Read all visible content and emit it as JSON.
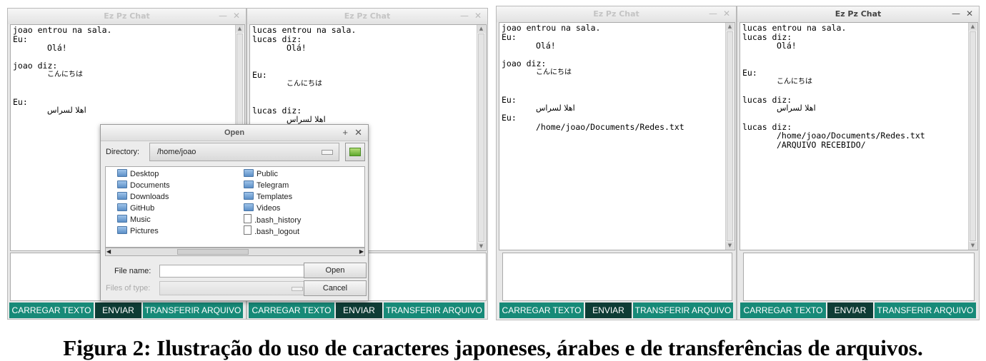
{
  "windows": [
    {
      "title": "Ez Pz Chat",
      "lines": [
        "joao entrou na sala.",
        "Eu:",
        "Olá!",
        "",
        "joao diz:",
        "こんにちは",
        "",
        "",
        "Eu:",
        "اهلا لسراس"
      ],
      "buttons": [
        "CARREGAR TEXTO",
        "ENVIAR",
        "TRANSFERIR ARQUIVO"
      ]
    },
    {
      "title": "Ez Pz Chat",
      "lines": [
        "lucas entrou na sala.",
        "lucas diz:",
        "Olá!",
        "",
        "",
        "Eu:",
        "こんにちは",
        "",
        "",
        "lucas diz:",
        "اهلا لسراس"
      ],
      "buttons": [
        "CARREGAR TEXTO",
        "ENVIAR",
        "TRANSFERIR ARQUIVO"
      ]
    },
    {
      "title": "Ez Pz Chat",
      "lines": [
        "joao entrou na sala.",
        "Eu:",
        "Olá!",
        "",
        "joao diz:",
        "こんにちは",
        "",
        "",
        "Eu:",
        "اهلا لسراس",
        "Eu:",
        "/home/joao/Documents/Redes.txt"
      ],
      "buttons": [
        "CARREGAR TEXTO",
        "ENVIAR",
        "TRANSFERIR ARQUIVO"
      ]
    },
    {
      "title": "Ez Pz Chat",
      "lines": [
        "lucas entrou na sala.",
        "lucas diz:",
        "Olá!",
        "",
        "",
        "Eu:",
        "こんにちは",
        "",
        "lucas diz:",
        "اهلا لسراس",
        "",
        "lucas diz:",
        "/home/joao/Documents/Redes.txt",
        "/ARQUIVO RECEBIDO/"
      ],
      "buttons": [
        "CARREGAR TEXTO",
        "ENVIAR",
        "TRANSFERIR ARQUIVO"
      ]
    }
  ],
  "dialog": {
    "title": "Open",
    "directory_label": "Directory:",
    "directory_value": "/home/joao",
    "files_left": [
      "Desktop",
      "Documents",
      "Downloads",
      "GitHub",
      "Music",
      "Pictures"
    ],
    "files_right": [
      "Public",
      "Telegram",
      "Templates",
      "Videos",
      ".bash_history",
      ".bash_logout"
    ],
    "file_name_label": "File name:",
    "file_name_value": "",
    "files_of_type_label": "Files of type:",
    "open_label": "Open",
    "cancel_label": "Cancel"
  },
  "caption": "Figura 2: Ilustração do uso de caracteres japoneses, árabes e de transferências de arquivos."
}
